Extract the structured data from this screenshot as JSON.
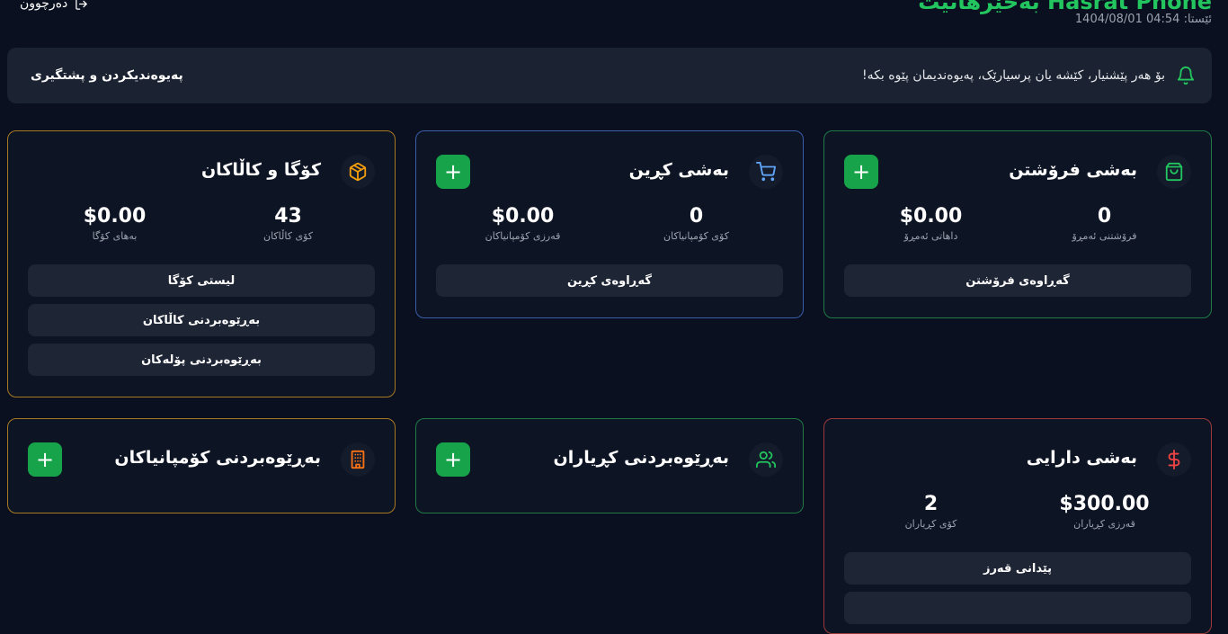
{
  "header": {
    "logout_label": "دەرچوون",
    "brand": "بەخێرهاتیت Hasrat Phone",
    "datetime": "ئێستا: 04:54 1404/08/01"
  },
  "banner": {
    "message": "بۆ هەر پێشنیار، کێشە یان پرسیارێک، پەیوەندیمان پێوە بکە!",
    "button_label": "پەیوەندیکردن و پشتگیری"
  },
  "cards": {
    "sales": {
      "title": "بەشی فرۆشتن",
      "stat1_value": "0",
      "stat1_label": "فرۆشتنی ئەمڕۆ",
      "stat2_value": "$0.00",
      "stat2_label": "داهاتی ئەمڕۆ",
      "btn1": "گەڕاوەی فرۆشتن",
      "border": "#1f7a45",
      "icon_color": "#22c55e"
    },
    "purchase": {
      "title": "بەشی کڕین",
      "stat1_value": "0",
      "stat1_label": "کۆی کۆمپانیاکان",
      "stat2_value": "$0.00",
      "stat2_label": "قەرزی کۆمپانیاکان",
      "btn1": "گەڕاوەی کڕین",
      "border": "#3b5cab",
      "icon_color": "#60a5fa"
    },
    "inventory": {
      "title": "کۆگا و کاڵاکان",
      "stat1_value": "43",
      "stat1_label": "کۆی کاڵاکان",
      "stat2_value": "$0.00",
      "stat2_label": "بەهای کۆگا",
      "btn1": "لیستی کۆگا",
      "btn2": "بەڕێوەبردنی کاڵاکان",
      "btn3": "بەڕێوەبردنی پۆلەکان",
      "border": "#a87822",
      "icon_color": "#f59e0b"
    },
    "finance": {
      "title": "بەشی دارایی",
      "stat1_value": "$300.00",
      "stat1_label": "قەرزی کڕیاران",
      "stat2_value": "2",
      "stat2_label": "کۆی کڕیاران",
      "btn1": "پێدانی قەرز",
      "border": "#9b3a3a",
      "icon_color": "#ef4444"
    },
    "customers": {
      "title": "بەڕێوەبردنی کڕیاران",
      "border": "#1f7a45",
      "icon_color": "#22c55e"
    },
    "companies": {
      "title": "بەڕێوەبردنی کۆمپانیاکان",
      "border": "#a87822",
      "icon_color": "#f97316"
    }
  },
  "icons": {
    "logout": "logout-icon",
    "bell": "bell-icon",
    "sales": "shopping-bag-icon",
    "purchase": "cart-icon",
    "inventory": "box-icon",
    "finance": "dollar-icon",
    "customers": "users-icon",
    "companies": "building-icon",
    "plus": "plus-icon"
  }
}
